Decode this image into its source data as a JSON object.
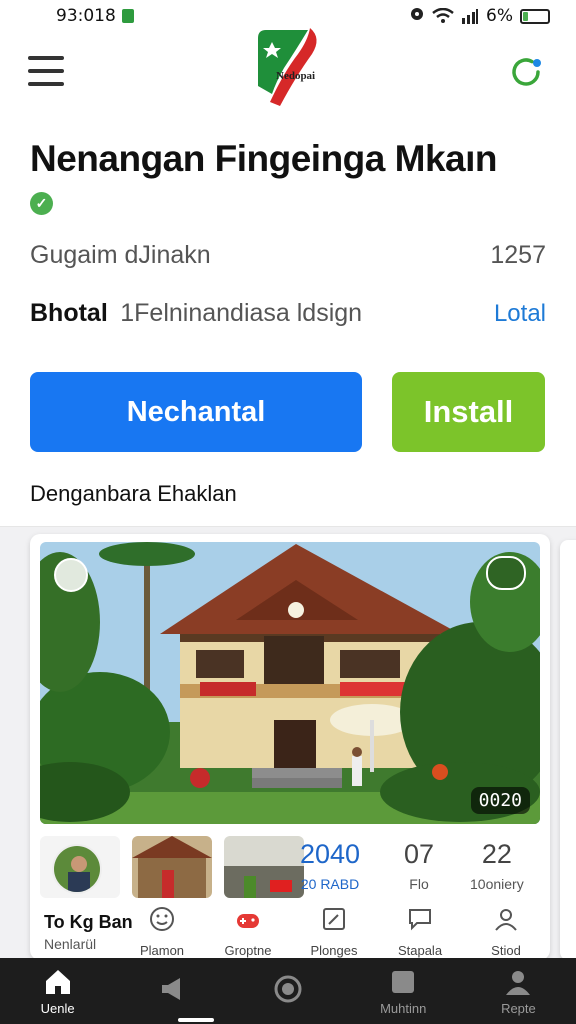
{
  "status_bar": {
    "time": "93:018",
    "battery_percent": "6%",
    "battery_level": 0.06
  },
  "app_bar": {
    "logo_text": "Nedopai"
  },
  "app": {
    "title": "Nenangan Fingeinga Mkaın",
    "stat_label": "Gugaim dJinakn",
    "stat_value": "1257",
    "developer": "Bhotal",
    "developer_sub": "1Felninandiasa ldsign",
    "location": "Lotal",
    "primary_button": "Nechantal",
    "install_button": "Install",
    "section_label": "Denganbara Ehaklan"
  },
  "card": {
    "photo_badge": "0020",
    "stats": [
      {
        "num": "2040",
        "label": "20 RABD"
      },
      {
        "num": "07",
        "label": "Flo"
      },
      {
        "num": "22",
        "label": "10oniery"
      }
    ],
    "caption_main": "To Kg Ban",
    "caption_sub": "Nenlarül",
    "actions": [
      {
        "label": "Plamon",
        "icon": "smiley-icon"
      },
      {
        "label": "Groptne",
        "icon": "gamepad-icon"
      },
      {
        "label": "Plonges",
        "icon": "edit-icon"
      },
      {
        "label": "Stapala",
        "icon": "chat-icon"
      },
      {
        "label": "Stiod",
        "icon": "person-icon"
      }
    ]
  },
  "bottom_nav": [
    {
      "label": "Uenle",
      "icon": "home-icon"
    },
    {
      "label": "",
      "icon": "megaphone-icon"
    },
    {
      "label": "",
      "icon": "record-icon"
    },
    {
      "label": "Muhtinn",
      "icon": "square-icon"
    },
    {
      "label": "Repte",
      "icon": "profile-icon"
    }
  ],
  "colors": {
    "primary": "#1877f2",
    "install": "#7cc42a",
    "link": "#1e7ad6",
    "nav_bg": "#1d1d1d"
  }
}
